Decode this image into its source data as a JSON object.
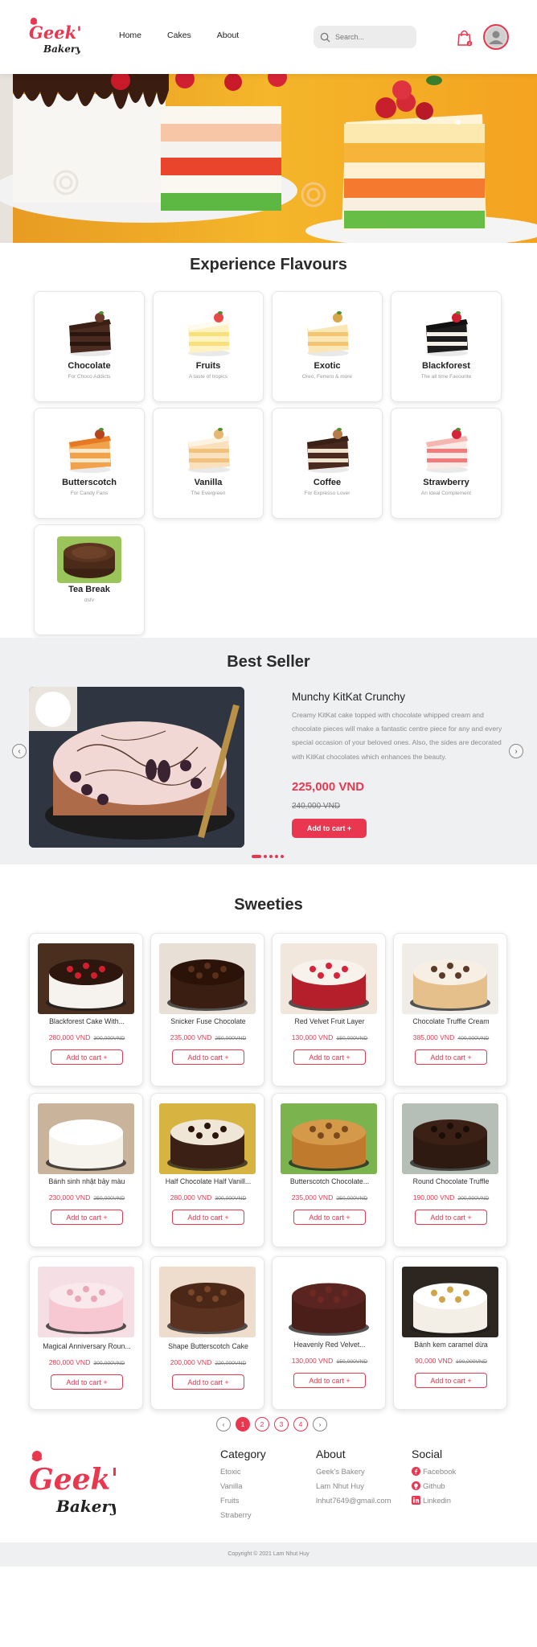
{
  "header": {
    "logo_line1": "Geek's",
    "logo_line2": "Bakery",
    "nav": [
      "Home",
      "Cakes",
      "About"
    ],
    "search_placeholder": "Search...",
    "cart_count": "0"
  },
  "flavours": {
    "title": "Experience Flavours",
    "items": [
      {
        "name": "Chocolate",
        "desc": "For Choco Addicts"
      },
      {
        "name": "Fruits",
        "desc": "A taste of tropics"
      },
      {
        "name": "Exotic",
        "desc": "Oreo, Ferrero & more"
      },
      {
        "name": "Blackforest",
        "desc": "The all time Favourite"
      },
      {
        "name": "Butterscotch",
        "desc": "For Candy Fans"
      },
      {
        "name": "Vanilla",
        "desc": "The Evergreen"
      },
      {
        "name": "Coffee",
        "desc": "For Expresso Lover"
      },
      {
        "name": "Strawberry",
        "desc": "An ideal Complement"
      },
      {
        "name": "Tea Break",
        "desc": "dsfv"
      }
    ]
  },
  "best_seller": {
    "title": "Best Seller",
    "name": "Munchy KitKat Crunchy",
    "description": "Creamy KitKat cake topped with chocolate whipped cream and chocolate pieces will make a fantastic centre piece for any and every special occasion of your beloved ones. Also, the sides are decorated with KitKat chocolates which enhances the beauty.",
    "price": "225,000 VND",
    "old_price": "240,000 VND",
    "button": "Add to cart +",
    "prev": "‹",
    "next": "›"
  },
  "sweeties": {
    "title": "Sweeties",
    "button": "Add to cart +",
    "products": [
      {
        "name": "Blackforest Cake With...",
        "price": "280,000 VND",
        "old": "300,000VND"
      },
      {
        "name": "Snicker Fuse Chocolate",
        "price": "235,000 VND",
        "old": "250,000VND"
      },
      {
        "name": "Red Velvet Fruit Layer",
        "price": "130,000 VND",
        "old": "150,000VND"
      },
      {
        "name": "Chocolate Truffle Cream",
        "price": "385,000 VND",
        "old": "400,000VND"
      },
      {
        "name": "Bánh sinh nhật bảy màu",
        "price": "230,000 VND",
        "old": "250,000VND"
      },
      {
        "name": "Half Chocolate Half Vanill...",
        "price": "280,000 VND",
        "old": "300,000VND"
      },
      {
        "name": "Butterscotch Chocolate...",
        "price": "235,000 VND",
        "old": "250,000VND"
      },
      {
        "name": "Round Chocolate Truffle",
        "price": "190,000 VND",
        "old": "200,000VND"
      },
      {
        "name": "Magical Anniversary Roun...",
        "price": "280,000 VND",
        "old": "300,000VND"
      },
      {
        "name": "Shape Butterscotch Cake",
        "price": "200,000 VND",
        "old": "220,000VND"
      },
      {
        "name": "Heavenly Red Velvet...",
        "price": "130,000 VND",
        "old": "150,000VND"
      },
      {
        "name": "Bánh kem caramel dừa",
        "price": "90,000 VND",
        "old": "100,000VND"
      }
    ]
  },
  "pagination": {
    "prev": "‹",
    "pages": [
      "1",
      "2",
      "3",
      "4"
    ],
    "next": "›",
    "current": "1"
  },
  "footer": {
    "category": {
      "heading": "Category",
      "links": [
        "Etoxic",
        "Vanilla",
        "Fruits",
        "Straberry"
      ]
    },
    "about": {
      "heading": "About",
      "links": [
        "Geek's Bakery",
        "Lam Nhut Huy",
        "lnhut7649@gmail.com"
      ]
    },
    "social": {
      "heading": "Social",
      "links": [
        "Facebook",
        "Github",
        "Linkedin"
      ]
    },
    "copyright": "Copyright © 2021 Lam Nhut Huy"
  },
  "colors": {
    "accent": "#e8374f",
    "section_bg": "#eef0f2"
  }
}
